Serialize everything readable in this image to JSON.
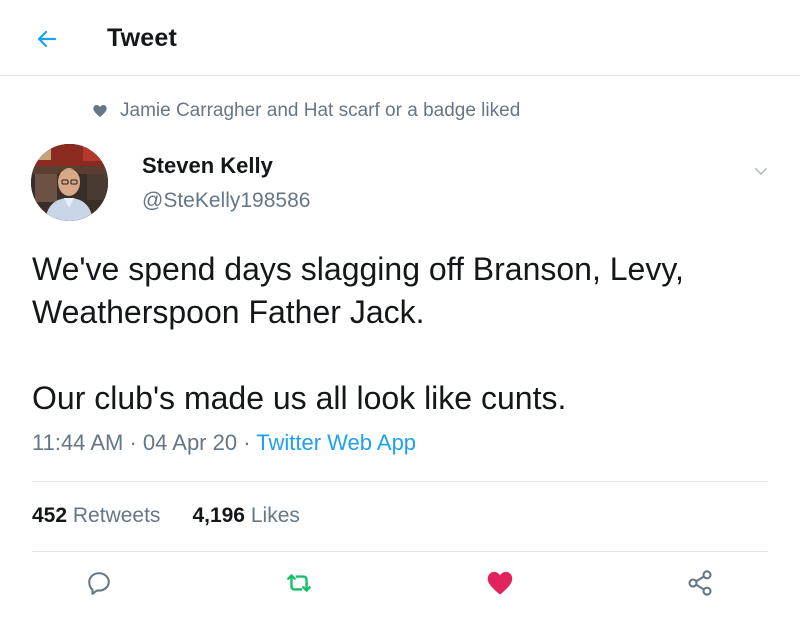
{
  "header": {
    "title": "Tweet",
    "back_icon": "arrow-left-icon"
  },
  "social_context": {
    "text": "Jamie Carragher and Hat scarf or a badge liked",
    "icon": "heart-icon"
  },
  "tweet": {
    "author": {
      "display_name": "Steven Kelly",
      "handle": "@SteKelly198586"
    },
    "text_paragraphs": [
      "We've spend days slagging off Branson, Levy, Weatherspoon Father Jack.",
      "Our club's made us all look like cunts."
    ],
    "time": "11:44 AM",
    "separator": "·",
    "date": "04 Apr 20",
    "source": "Twitter Web App"
  },
  "stats": {
    "retweets_count": "452",
    "retweets_label": "Retweets",
    "likes_count": "4,196",
    "likes_label": "Likes"
  },
  "actions": {
    "reply_icon": "reply-icon",
    "retweet_icon": "retweet-icon",
    "like_icon": "heart-icon",
    "share_icon": "share-icon"
  },
  "colors": {
    "accent": "#1da1f2",
    "retweet": "#17bf63",
    "like": "#e0245e",
    "muted": "#657786",
    "text": "#14171a",
    "divider": "#e1e8ed"
  }
}
